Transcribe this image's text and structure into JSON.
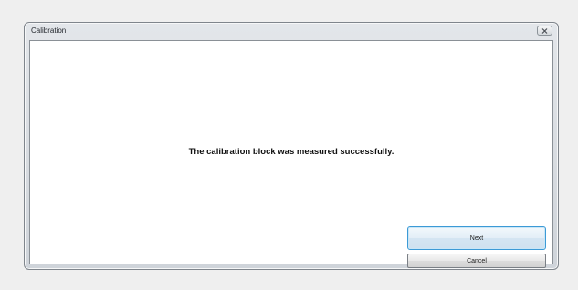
{
  "window": {
    "title": "Calibration"
  },
  "dialog": {
    "message": "The calibration block was measured successfully."
  },
  "buttons": {
    "next_label": "Next",
    "cancel_label": "Cancel"
  },
  "icons": {
    "close": "close-icon"
  },
  "colors": {
    "desktop_background": "#efefef",
    "window_frame": "#d7dbe0",
    "client_background": "#ffffff",
    "focus_border": "#3c9ad6"
  }
}
